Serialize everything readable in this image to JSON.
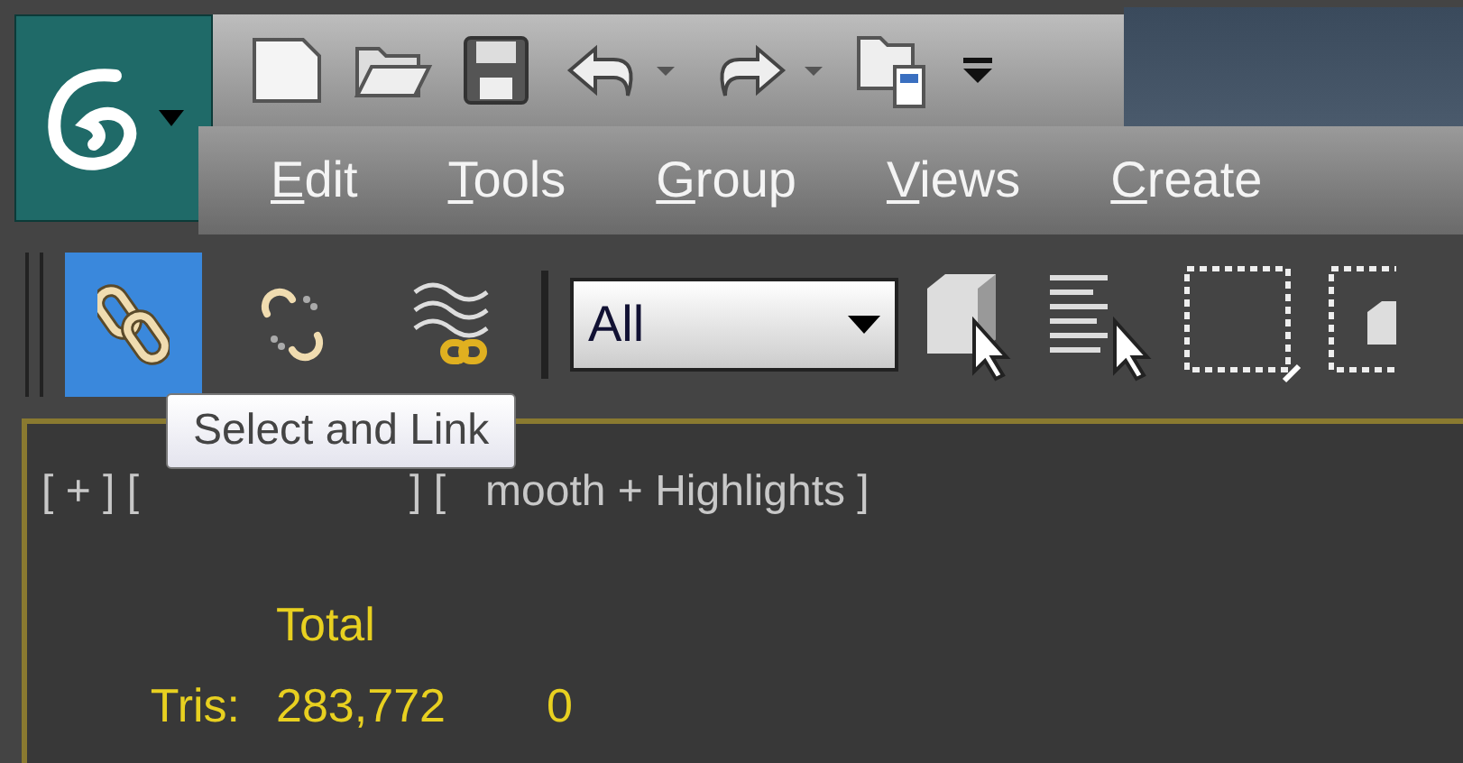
{
  "menu": [
    {
      "label": "Edit"
    },
    {
      "label": "Tools"
    },
    {
      "label": "Group"
    },
    {
      "label": "Views"
    },
    {
      "label": "Create"
    }
  ],
  "main_toolbar": {
    "link_tools": [
      {
        "selected": true
      },
      {
        "selected": false
      },
      {
        "selected": false
      }
    ],
    "selection_filter": {
      "value": "All"
    }
  },
  "tooltip": "Select and Link",
  "viewport": {
    "labels": [
      "[ + ] [",
      "] [",
      "mooth + Highlights ]"
    ],
    "stats": {
      "header": "Total",
      "rows": [
        {
          "label": "Tris:",
          "total": "283,772",
          "column_3": "0"
        }
      ]
    }
  }
}
